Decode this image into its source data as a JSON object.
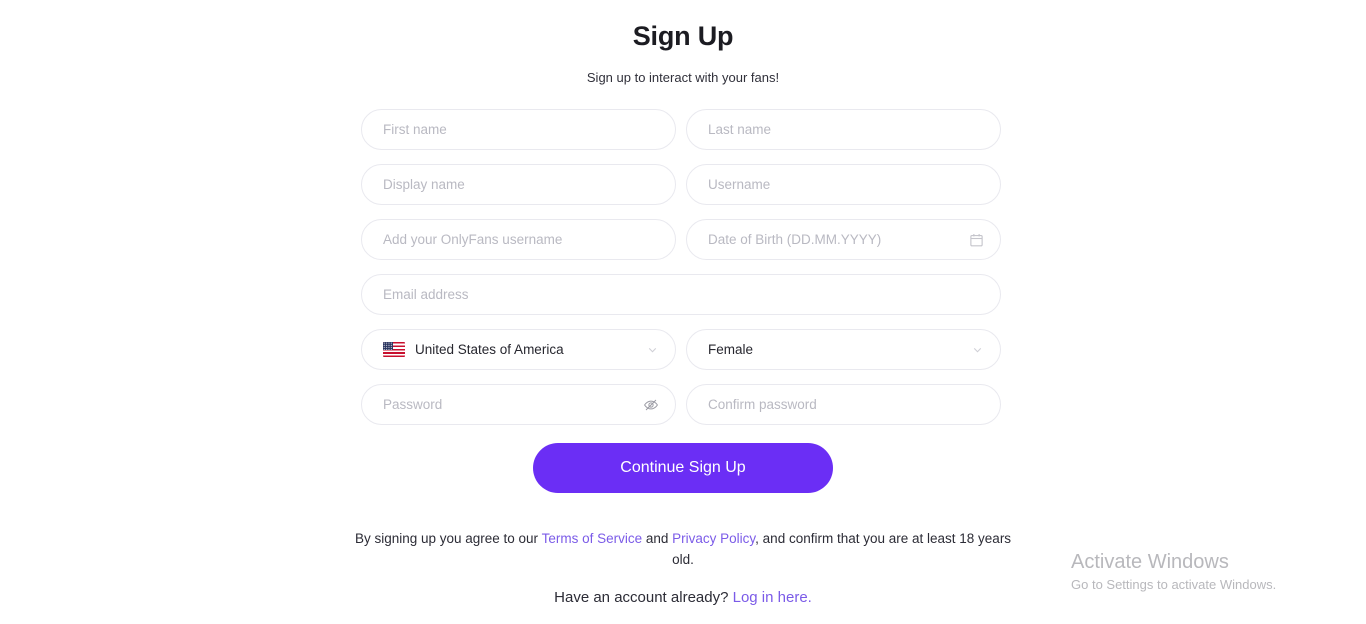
{
  "header": {
    "title": "Sign Up",
    "subtitle": "Sign up to interact with your fans!"
  },
  "form": {
    "first_name_placeholder": "First name",
    "last_name_placeholder": "Last name",
    "display_name_placeholder": "Display name",
    "username_placeholder": "Username",
    "onlyfans_username_placeholder": "Add your OnlyFans username",
    "date_of_birth_placeholder": "Date of Birth (DD.MM.YYYY)",
    "email_placeholder": "Email address",
    "country_value": "United States of America",
    "gender_value": "Female",
    "password_placeholder": "Password",
    "confirm_password_placeholder": "Confirm password"
  },
  "submit": {
    "label": "Continue Sign Up",
    "color": "#6B2EF5"
  },
  "legal": {
    "text_before_terms": "By signing up you agree to our ",
    "terms_label": "Terms of Service",
    "text_between": " and ",
    "privacy_label": "Privacy Policy",
    "text_after": ", and confirm that you are at least 18 years old.",
    "link_color": "#7B5BE8"
  },
  "login_prompt": {
    "text": "Have an account already?",
    "link_label": "Log in here."
  },
  "watermark": {
    "title": "Activate Windows",
    "subtitle": "Go to Settings to activate Windows."
  },
  "icons": {
    "calendar": "calendar-icon",
    "eye_off": "eye-off-icon",
    "chevron_down": "chevron-down-icon",
    "flag": "us-flag-icon"
  }
}
